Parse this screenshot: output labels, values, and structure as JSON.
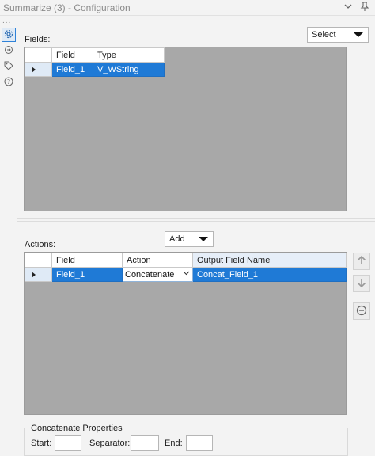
{
  "window": {
    "title": "Summarize (3) - Configuration"
  },
  "rail": {
    "more": "..."
  },
  "fields": {
    "label": "Fields:",
    "select_label": "Select",
    "columns": [
      "Field",
      "Type"
    ],
    "rows": [
      {
        "field": "Field_1",
        "type": "V_WString"
      }
    ]
  },
  "actions": {
    "label": "Actions:",
    "add_label": "Add",
    "columns": [
      "Field",
      "Action",
      "Output Field Name"
    ],
    "rows": [
      {
        "field": "Field_1",
        "action": "Concatenate",
        "output": "Concat_Field_1"
      }
    ]
  },
  "properties": {
    "title": "Concatenate Properties",
    "start_label": "Start:",
    "separator_label": "Separator:",
    "end_label": "End:",
    "start_value": "",
    "separator_value": "",
    "end_value": ""
  },
  "colors": {
    "accent": "#1f7ad6",
    "grid_bg": "#a8a8a8",
    "row_header": "#dfeaf6"
  }
}
